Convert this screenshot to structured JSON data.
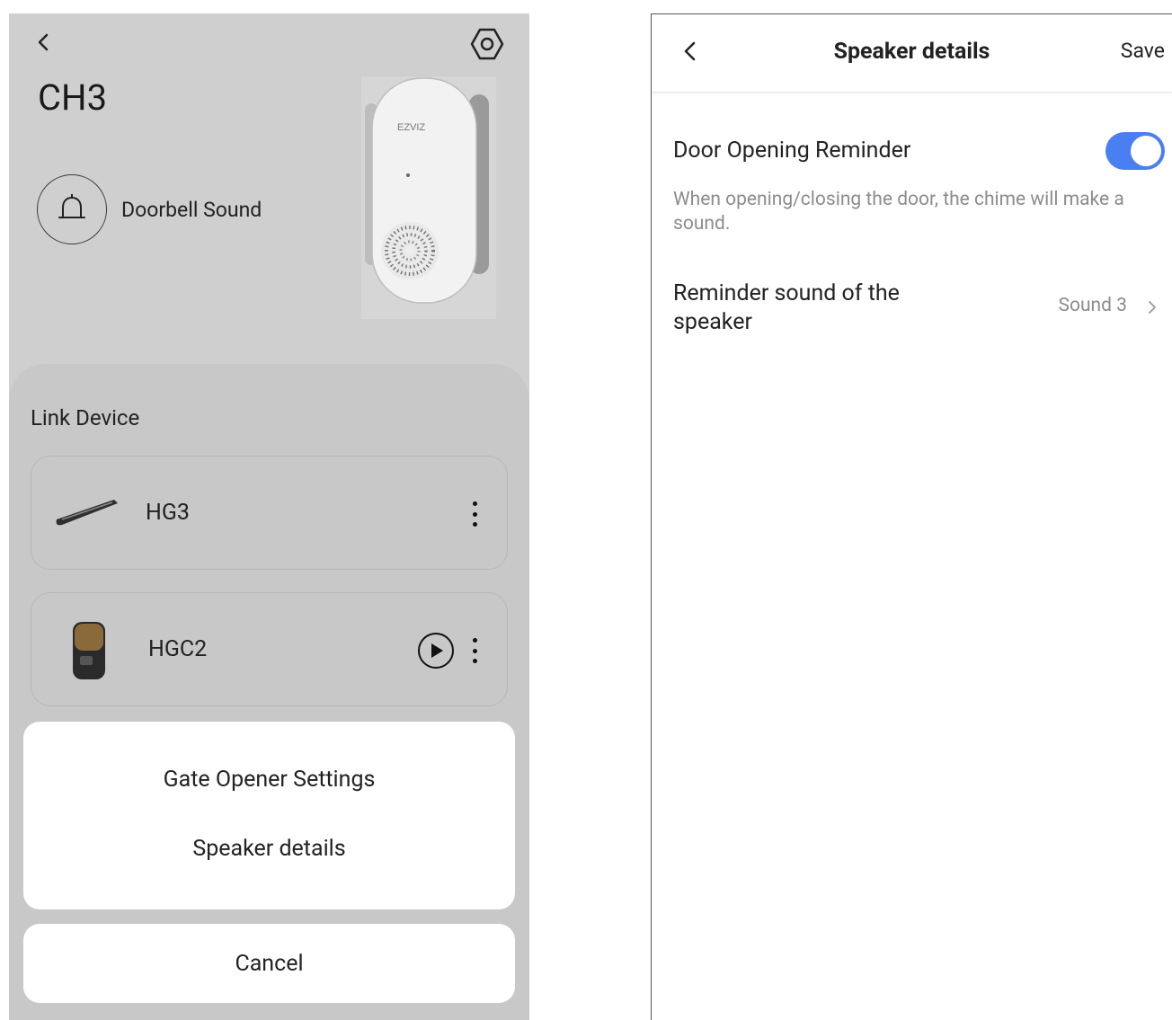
{
  "left_screen": {
    "device_title": "CH3",
    "doorbell_sound_label": "Doorbell Sound",
    "link_device_title": "Link Device",
    "devices": [
      {
        "name": "HG3"
      },
      {
        "name": "HGC2"
      }
    ],
    "action_sheet": {
      "items": [
        "Gate Opener Settings",
        "Speaker details"
      ],
      "cancel_label": "Cancel"
    },
    "brand_text": "EZVIZ"
  },
  "right_screen": {
    "title": "Speaker details",
    "save_label": "Save",
    "door_opening_reminder_label": "Door Opening Reminder",
    "door_opening_reminder_enabled": true,
    "door_opening_reminder_description": "When opening/closing the door, the chime will make a sound.",
    "reminder_sound_label": "Reminder sound of the speaker",
    "reminder_sound_value": "Sound 3"
  },
  "colors": {
    "toggle_on": "#4a7ff2",
    "dim_background": "#cfcfcf",
    "secondary_text": "#8c8c8c"
  }
}
